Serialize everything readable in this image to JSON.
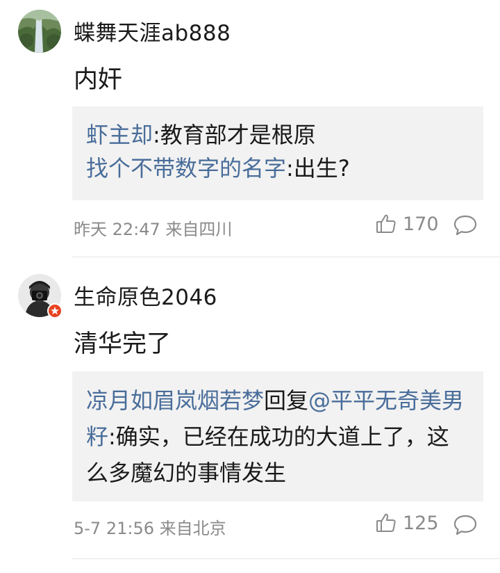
{
  "comments": [
    {
      "username": "蝶舞天涯ab888",
      "text": "内奸",
      "replies": [
        {
          "user": "虾主却",
          "sep": ":",
          "text": "教育部才是根原"
        },
        {
          "user": "找个不带数字的名字",
          "sep": ":",
          "text": "出生?"
        }
      ],
      "meta": "昨天 22:47 来自四川",
      "likes": "170"
    },
    {
      "username": "生命原色2046",
      "text": "清华完了",
      "replies": [
        {
          "user": "凉月如眉岚烟若梦",
          "mid": "回复",
          "mention": "@平平无奇美男籽",
          "sep": ":",
          "text": "确实，已经在成功的大道上了，这么多魔幻的事情发生"
        }
      ],
      "meta": "5-7 21:56 来自北京",
      "likes": "125"
    }
  ],
  "colors": {
    "link": "#496d9a",
    "meta": "#8a8a8a",
    "reply_bg": "#f2f2f2",
    "badge": "#e8431f"
  },
  "icons": {
    "like": "thumbs-up-icon",
    "reply": "comment-bubble-icon",
    "badge": "verified-badge-icon"
  }
}
